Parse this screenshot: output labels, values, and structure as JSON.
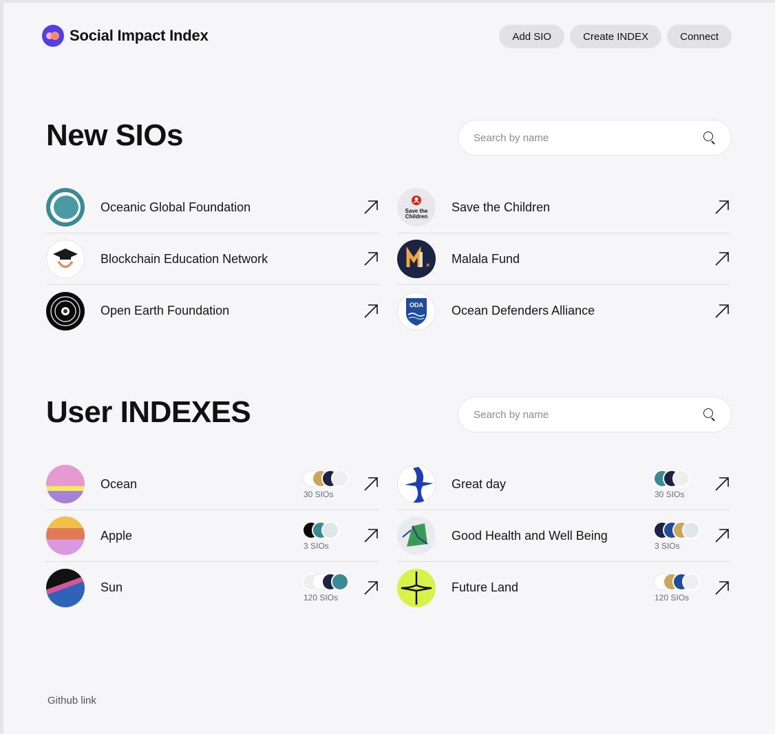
{
  "header": {
    "brand": "Social Impact Index",
    "nav": [
      "Add SIO",
      "Create INDEX",
      "Connect"
    ]
  },
  "new_sios": {
    "title": "New SIOs",
    "search_placeholder": "Search by name",
    "items": [
      {
        "name": "Oceanic Global Foundation",
        "icon": "oceanic-logo"
      },
      {
        "name": "Save the Children",
        "icon": "save-the-children-logo",
        "logo_text": "Save the Children"
      },
      {
        "name": "Blockchain Education Network",
        "icon": "graduation-cap-logo"
      },
      {
        "name": "Malala Fund",
        "icon": "malala-logo"
      },
      {
        "name": "Open Earth Foundation",
        "icon": "earth-logo"
      },
      {
        "name": "Ocean Defenders Alliance",
        "icon": "oda-shield-logo",
        "logo_text": "ODA"
      }
    ]
  },
  "user_indexes": {
    "title": "User INDEXES",
    "search_placeholder": "Search by name",
    "items": [
      {
        "name": "Ocean",
        "count": "30 SIOs"
      },
      {
        "name": "Great day",
        "count": "30 SIOs"
      },
      {
        "name": "Apple",
        "count": "3 SIOs"
      },
      {
        "name": "Good Health and Well Being",
        "count": "3 SIOs"
      },
      {
        "name": "Sun",
        "count": "120 SIOs"
      },
      {
        "name": "Future Land",
        "count": "120 SIOs"
      }
    ]
  },
  "footer": {
    "link": "Github link"
  },
  "colors": {
    "background": "#f6f6f8",
    "button": "#e1e1e6",
    "brand": "#5140e6",
    "brand_accent": "#ff8a6b"
  }
}
